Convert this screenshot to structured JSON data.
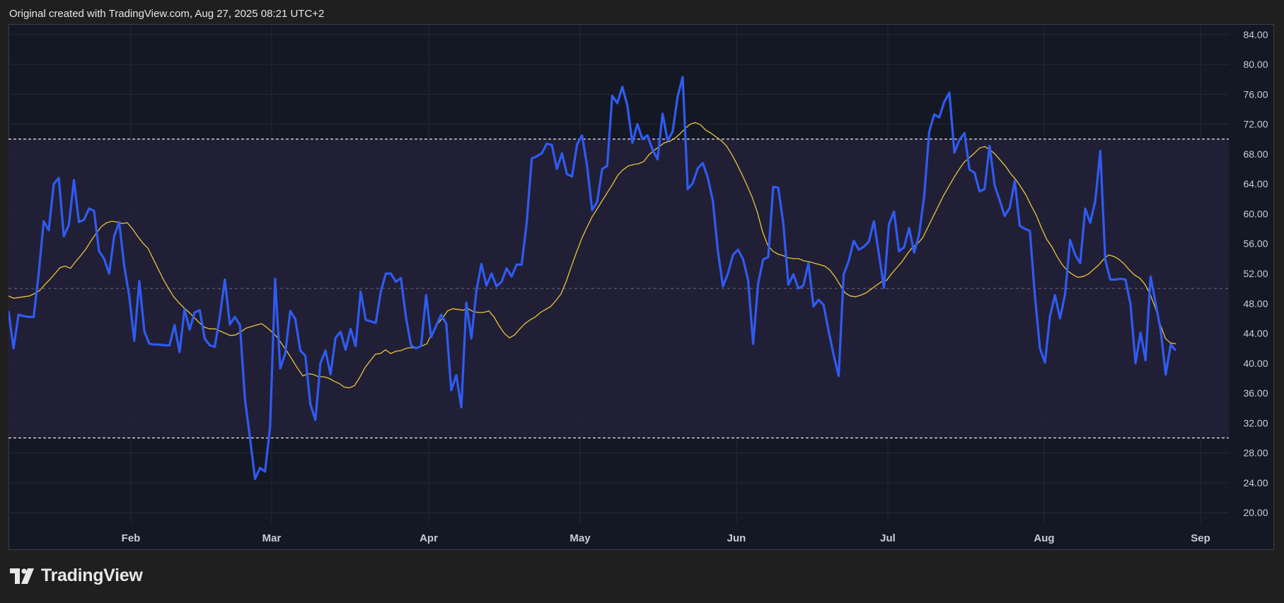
{
  "header": {
    "note": "Original created with TradingView.com, Aug 27, 2025 08:21 UTC+2"
  },
  "footer": {
    "brand": "TradingView"
  },
  "colors": {
    "rsi": "#2f5bf2",
    "rsi_ma": "#e6c43a",
    "band": "#23213a",
    "background": "#141824",
    "grid": "#232838"
  },
  "chart_data": {
    "type": "line",
    "y_ticks": [
      "84.00",
      "80.00",
      "76.00",
      "72.00",
      "68.00",
      "64.00",
      "60.00",
      "56.00",
      "52.00",
      "48.00",
      "44.00",
      "40.00",
      "36.00",
      "32.00",
      "28.00",
      "24.00",
      "20.00"
    ],
    "x_ticks": [
      "Feb",
      "Mar",
      "Apr",
      "May",
      "Jun",
      "Jul",
      "Aug",
      "Sep"
    ],
    "ylim": [
      18.6,
      85.4
    ],
    "overbought": 70,
    "oversold": 30,
    "midline": 50,
    "grid": true,
    "series": [
      {
        "role": "rsi",
        "values": [
          47,
          42,
          46.5,
          46.3,
          46.2,
          46.2,
          52,
          59,
          57.8,
          64,
          64.8,
          57,
          58.5,
          64.5,
          58.9,
          59.2,
          60.7,
          60.4,
          55,
          54,
          52,
          57,
          58.9,
          53,
          49,
          43,
          51,
          44.3,
          42.6,
          42.5,
          42.5,
          42.4,
          42.4,
          45.1,
          41.5,
          47.2,
          44.5,
          46.8,
          47.1,
          43.3,
          42.4,
          42.2,
          46.2,
          51.2,
          45.2,
          46.2,
          45.1,
          35.1,
          30,
          24.5,
          26,
          25.5,
          31.5,
          51.3,
          39.3,
          41.3,
          47,
          45.9,
          41.7,
          41,
          34.5,
          32.4,
          40,
          41.7,
          38.5,
          43.4,
          44.2,
          41.8,
          44.6,
          42.3,
          49.6,
          45.8,
          45.6,
          45.4,
          49.6,
          52,
          52,
          50.9,
          51.4,
          46.1,
          42.4,
          42,
          42.3,
          49.1,
          43.5,
          45,
          46.5,
          45.3,
          36.4,
          38.4,
          34.1,
          48.1,
          43.3,
          49.7,
          53.3,
          50.4,
          52,
          50.3,
          50.9,
          52.7,
          51.6,
          53.2,
          53.2,
          58.8,
          67.4,
          67.7,
          68.1,
          69.4,
          69.2,
          66,
          68.1,
          65.3,
          65,
          69.3,
          70.5,
          66.4,
          60.5,
          61.6,
          66,
          66.4,
          75.8,
          74.8,
          77,
          74.5,
          69.5,
          72,
          70,
          70.5,
          68.6,
          67.3,
          73.4,
          69.8,
          71,
          75.7,
          78.3,
          63.3,
          64.1,
          66.1,
          66.8,
          64.8,
          61.7,
          55,
          50.3,
          52,
          54.5,
          55.2,
          53.9,
          51.1,
          42.6,
          50.7,
          53.9,
          54.2,
          63.6,
          63.5,
          58.7,
          50.5,
          51.9,
          50,
          50.4,
          53.4,
          47.6,
          48.5,
          47.8,
          44.3,
          41.1,
          38.3,
          51.9,
          53.7,
          56.4,
          55.2,
          55.6,
          56.3,
          59,
          54.6,
          50.1,
          58.6,
          60.3,
          55,
          55.5,
          58.1,
          54.8,
          57.3,
          62.4,
          71,
          73.3,
          72.9,
          75,
          76.2,
          68.2,
          69.9,
          70.8,
          65.9,
          65.5,
          63,
          63.3,
          69.1,
          63.8,
          61.8,
          59.7,
          60.8,
          64.4,
          58.4,
          58,
          57.7,
          49,
          42,
          40.1,
          46.3,
          49.1,
          46,
          49.2,
          56.5,
          54.5,
          53.4,
          60.7,
          58.8,
          61.7,
          68.4,
          53.8,
          51.2,
          51.2,
          51.3,
          51.2,
          47.9,
          40,
          44.1,
          40.4,
          51.6,
          48,
          44.4,
          38.5,
          42.5,
          41.7
        ]
      },
      {
        "role": "rsi_ma",
        "values": [
          49,
          48.7,
          48.8,
          48.9,
          49,
          49.3,
          49.7,
          50.5,
          51.2,
          52,
          52.8,
          53,
          52.7,
          53.6,
          54.4,
          55.3,
          56.4,
          57.4,
          58.3,
          58.8,
          59,
          58.9,
          58.7,
          58.8,
          58,
          57,
          56.1,
          55.4,
          54,
          52.6,
          51.2,
          50,
          48.9,
          48.1,
          47.4,
          46.8,
          46.1,
          45.4,
          44.8,
          44.6,
          44.6,
          44.3,
          44,
          43.7,
          43.8,
          44.2,
          44.7,
          44.9,
          45.1,
          45.3,
          44.8,
          44.2,
          43.5,
          42.5,
          41.5,
          40.4,
          39.3,
          38.3,
          38.6,
          38.5,
          38.2,
          38.2,
          38,
          37.6,
          37.3,
          36.8,
          36.7,
          37,
          38.1,
          39.4,
          40.3,
          41.2,
          41.3,
          41.8,
          41.3,
          41.6,
          41.7,
          42,
          42.1,
          42,
          42.3,
          42.6,
          44,
          45.2,
          46,
          47,
          47.3,
          47.2,
          47.1,
          47.3,
          46.9,
          46.8,
          46.8,
          47,
          46.2,
          45,
          44,
          43.4,
          43.8,
          44.6,
          45.3,
          45.8,
          46.2,
          46.8,
          47.2,
          47.6,
          48.4,
          49.3,
          51,
          53,
          54.9,
          56.7,
          58.2,
          59.6,
          60.7,
          61.8,
          62.9,
          64,
          65.2,
          65.9,
          66.4,
          66.6,
          66.7,
          67,
          67.9,
          68.5,
          69,
          69.5,
          69.7,
          70.1,
          70.7,
          71.4,
          72,
          72.2,
          71.9,
          71.2,
          70.8,
          70.3,
          69.8,
          69.1,
          68,
          66.7,
          65.3,
          63.8,
          62.2,
          60.2,
          57.6,
          55.8,
          55,
          54.6,
          54.4,
          54.1,
          54,
          54,
          53.7,
          53.6,
          53.4,
          53.2,
          53,
          52.5,
          51.6,
          50.5,
          49.4,
          49,
          48.9,
          49.1,
          49.4,
          49.9,
          50.4,
          50.9,
          51.1,
          52,
          52.8,
          53.6,
          54.6,
          55.5,
          56,
          56.8,
          58.2,
          59.6,
          61,
          62.4,
          63.6,
          64.8,
          65.9,
          66.9,
          67.5,
          68.1,
          68.8,
          69,
          68.6,
          68,
          67.2,
          66.4,
          65.4,
          64.6,
          63.6,
          62.5,
          61.1,
          59.8,
          58.1,
          56.6,
          55.6,
          54.3,
          53.2,
          52.4,
          51.9,
          51.5,
          51.6,
          51.9,
          52.5,
          53.1,
          53.9,
          54.5,
          54.3,
          53.9,
          53.3,
          52.5,
          51.8,
          51.4,
          50.6,
          49.3,
          47.5,
          45.2,
          43.3,
          42.7,
          42.6
        ]
      }
    ]
  }
}
